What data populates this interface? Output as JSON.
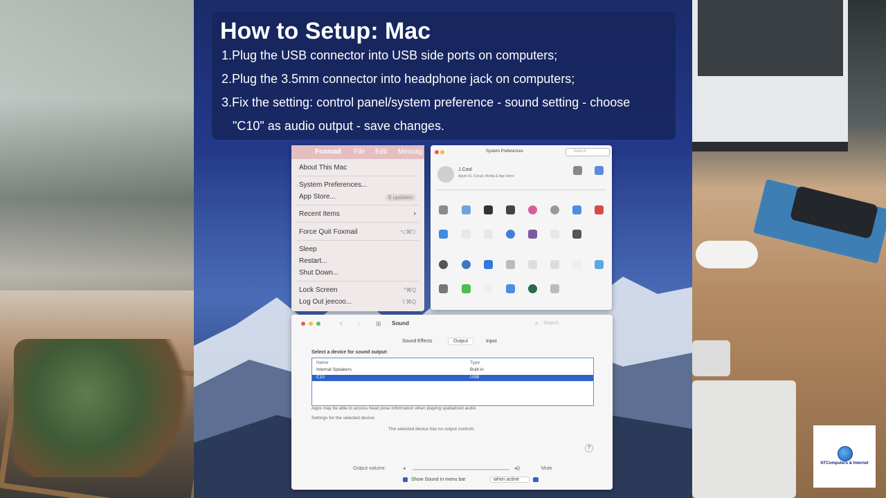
{
  "title": "How to Setup: Mac",
  "steps": [
    "1.Plug the USB connector into USB side ports on computers;",
    "2.Plug the 3.5mm connector into headphone jack on computers;",
    "3.Fix the setting: control panel/system preference - sound setting - choose",
    "\"C10\" as audio output - save changes."
  ],
  "apple_menu": {
    "menubar": [
      "Foxmail",
      "File",
      "Edit",
      "Messag"
    ],
    "items": {
      "about": "About This Mac",
      "sysprefs": "System Preferences...",
      "appstore": "App Store...",
      "appstore_badge": "8 updates",
      "recent": "Recent Items",
      "forcequit": "Force Quit Foxmail",
      "forcequit_shortcut": "⌥⌘⎋",
      "sleep": "Sleep",
      "restart": "Restart...",
      "shutdown": "Shut Down...",
      "lock": "Lock Screen",
      "lock_shortcut": "^⌘Q",
      "logout": "Log Out jeecoo...",
      "logout_shortcut": "⇧⌘Q"
    }
  },
  "sysprefs": {
    "title": "System Preferences",
    "search_placeholder": "Search",
    "user": "J.Cool",
    "user_sub": "Apple ID, iCloud, Media & App Store"
  },
  "sound": {
    "title": "Sound",
    "search_placeholder": "Search",
    "tabs": [
      "Sound Effects",
      "Output",
      "Input"
    ],
    "active_tab": "Output",
    "select_label": "Select a device for sound output:",
    "columns": [
      "Name",
      "Type"
    ],
    "devices": [
      {
        "name": "Internal Speakers",
        "type": "Built-in"
      },
      {
        "name": "C10",
        "type": "USB"
      }
    ],
    "selected_device": "C10",
    "spatial_note": "Apps may be able to access head pose information when playing spatialized audio.",
    "settings_label": "Settings for the selected device:",
    "no_controls": "The selected device has no output controls",
    "help": "?",
    "volume_label": "Output volume:",
    "mute_label": "Mute",
    "menubar_label": "Show Sound in menu bar",
    "menubar_option": "when active"
  },
  "logo": {
    "text": "NTComputers & Internet"
  },
  "colors": {
    "accent": "#2f62c9",
    "title_panel": "#162458"
  }
}
